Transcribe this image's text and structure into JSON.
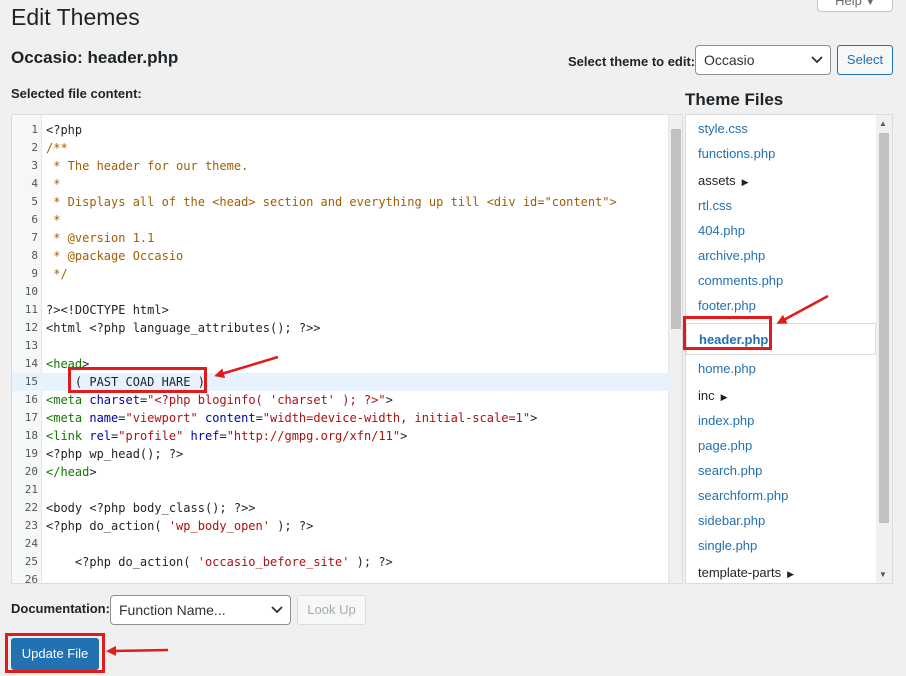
{
  "page": {
    "title": "Edit Themes",
    "help_label": "Help"
  },
  "file_title": "Occasio: header.php",
  "theme_selector": {
    "label": "Select theme to edit:",
    "selected": "Occasio",
    "button": "Select"
  },
  "editor": {
    "label": "Selected file content:",
    "active_line": 15,
    "lines": [
      {
        "n": "1",
        "t": "<?php"
      },
      {
        "n": "2",
        "t": "/**"
      },
      {
        "n": "3",
        "t": " * The header for our theme."
      },
      {
        "n": "4",
        "t": " *"
      },
      {
        "n": "5",
        "t": " * Displays all of the <head> section and everything up till <div id=\"content\">"
      },
      {
        "n": "6",
        "t": " *"
      },
      {
        "n": "7",
        "t": " * @version 1.1"
      },
      {
        "n": "8",
        "t": " * @package Occasio"
      },
      {
        "n": "9",
        "t": " */"
      },
      {
        "n": "10",
        "t": ""
      },
      {
        "n": "11",
        "t": "?><!DOCTYPE html>"
      },
      {
        "n": "12",
        "t": "<html <?php language_attributes(); ?>>"
      },
      {
        "n": "13",
        "t": ""
      },
      {
        "n": "14",
        "t": "<head>"
      },
      {
        "n": "15",
        "t": "    ( PAST COAD HARE )"
      },
      {
        "n": "16",
        "t": "<meta charset=\"<?php bloginfo( 'charset' ); ?>\">"
      },
      {
        "n": "17",
        "t": "<meta name=\"viewport\" content=\"width=device-width, initial-scale=1\">"
      },
      {
        "n": "18",
        "t": "<link rel=\"profile\" href=\"http://gmpg.org/xfn/11\">"
      },
      {
        "n": "19",
        "t": "<?php wp_head(); ?>"
      },
      {
        "n": "20",
        "t": "</head>"
      },
      {
        "n": "21",
        "t": ""
      },
      {
        "n": "22",
        "t": "<body <?php body_class(); ?>>"
      },
      {
        "n": "23",
        "t": "<?php do_action( 'wp_body_open' ); ?>"
      },
      {
        "n": "24",
        "t": ""
      },
      {
        "n": "25",
        "t": "    <?php do_action( 'occasio_before_site' ); ?>"
      },
      {
        "n": "26",
        "t": ""
      }
    ]
  },
  "theme_files": {
    "heading": "Theme Files",
    "items": [
      {
        "label": "style.css",
        "type": "file"
      },
      {
        "label": "functions.php",
        "type": "file"
      },
      {
        "label": "assets",
        "type": "dir"
      },
      {
        "label": "rtl.css",
        "type": "file"
      },
      {
        "label": "404.php",
        "type": "file"
      },
      {
        "label": "archive.php",
        "type": "file"
      },
      {
        "label": "comments.php",
        "type": "file"
      },
      {
        "label": "footer.php",
        "type": "file"
      },
      {
        "label": "header.php",
        "type": "current"
      },
      {
        "label": "home.php",
        "type": "file"
      },
      {
        "label": "inc",
        "type": "dir"
      },
      {
        "label": "index.php",
        "type": "file"
      },
      {
        "label": "page.php",
        "type": "file"
      },
      {
        "label": "search.php",
        "type": "file"
      },
      {
        "label": "searchform.php",
        "type": "file"
      },
      {
        "label": "sidebar.php",
        "type": "file"
      },
      {
        "label": "single.php",
        "type": "file"
      },
      {
        "label": "template-parts",
        "type": "dir"
      }
    ]
  },
  "documentation": {
    "label": "Documentation:",
    "selected": "Function Name...",
    "button": "Look Up"
  },
  "update_button": "Update File",
  "colors": {
    "primary": "#2271b1",
    "annotation_red": "#e01b1b",
    "active_line": "#e8f2ff"
  }
}
